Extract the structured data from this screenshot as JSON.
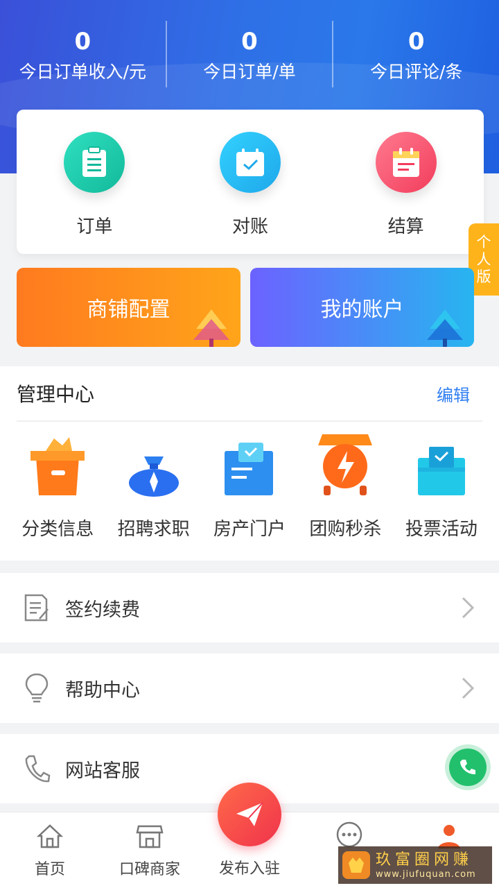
{
  "stats": [
    {
      "value": "0",
      "label": "今日订单收入/元"
    },
    {
      "value": "0",
      "label": "今日订单/单"
    },
    {
      "value": "0",
      "label": "今日评论/条"
    }
  ],
  "quick": [
    {
      "label": "订单",
      "icon": "order-clipboard-icon",
      "color": "#12b99a"
    },
    {
      "label": "对账",
      "icon": "calendar-check-icon",
      "color": "#1ea8ea"
    },
    {
      "label": "结算",
      "icon": "notepad-icon",
      "color": "#f23d5c"
    }
  ],
  "side_tab": {
    "chars": [
      "个",
      "人",
      "版"
    ]
  },
  "banners": [
    {
      "label": "商铺配置",
      "color": "#ff7a1f"
    },
    {
      "label": "我的账户",
      "color": "#6c62ff"
    }
  ],
  "management": {
    "title": "管理中心",
    "edit": "编辑",
    "items": [
      {
        "label": "分类信息",
        "icon": "box-icon"
      },
      {
        "label": "招聘求职",
        "icon": "money-bag-icon"
      },
      {
        "label": "房产门户",
        "icon": "house-document-icon"
      },
      {
        "label": "团购秒杀",
        "icon": "alarm-clock-icon"
      },
      {
        "label": "投票活动",
        "icon": "ballot-box-icon"
      }
    ]
  },
  "list": [
    {
      "label": "签约续费",
      "icon": "contract-icon"
    },
    {
      "label": "帮助中心",
      "icon": "lightbulb-icon"
    },
    {
      "label": "网站客服",
      "icon": "phone-icon"
    }
  ],
  "tabbar": [
    {
      "label": "首页",
      "icon": "home-icon"
    },
    {
      "label": "口碑商家",
      "icon": "store-icon"
    },
    {
      "label": "发布入驻",
      "icon": "paper-plane-icon"
    },
    {
      "label": "消",
      "icon": "chat-icon"
    },
    {
      "label": "",
      "icon": "user-icon"
    }
  ],
  "watermark": {
    "title": "玖富圈网赚",
    "url": "www.jiufuquan.com"
  },
  "colors": {
    "brand_blue": "#2f6fe6",
    "accent_orange": "#ffb31a",
    "link_blue": "#2f7ef0"
  }
}
